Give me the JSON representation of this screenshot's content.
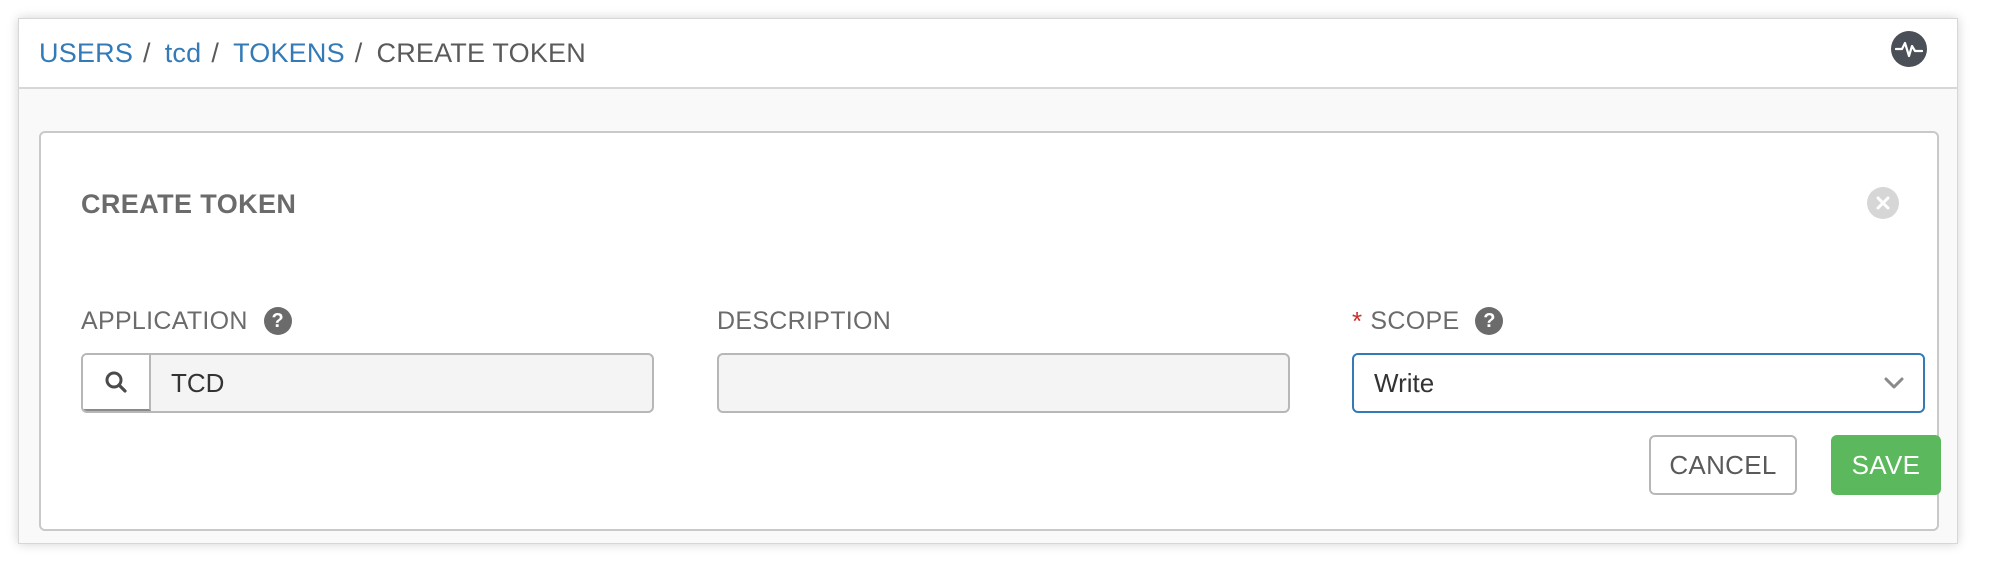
{
  "breadcrumb": {
    "items": [
      {
        "label": "USERS"
      },
      {
        "label": "tcd"
      },
      {
        "label": "TOKENS"
      },
      {
        "label": "CREATE TOKEN"
      }
    ],
    "separator": "/"
  },
  "topbar": {
    "activity_icon": "activity-stream-icon"
  },
  "panel": {
    "title": "CREATE TOKEN",
    "close_icon": "close-icon"
  },
  "form": {
    "application": {
      "label": "APPLICATION",
      "help_glyph": "?",
      "value": "TCD",
      "lookup_icon": "search-icon"
    },
    "description": {
      "label": "DESCRIPTION",
      "value": ""
    },
    "scope": {
      "required_mark": "*",
      "label": "SCOPE",
      "help_glyph": "?",
      "value": "Write"
    }
  },
  "actions": {
    "cancel_label": "CANCEL",
    "save_label": "SAVE"
  },
  "colors": {
    "link": "#337ab7",
    "save": "#5cb85c",
    "required": "#c9302c",
    "focus_border": "#337ab7"
  }
}
